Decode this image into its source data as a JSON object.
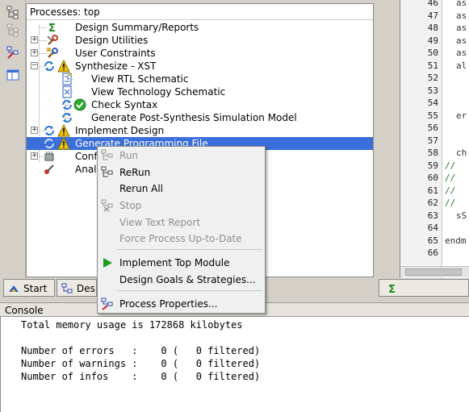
{
  "process_panel": {
    "header": "Processes: top",
    "items": [
      {
        "label": "Design Summary/Reports"
      },
      {
        "label": "Design Utilities"
      },
      {
        "label": "User Constraints"
      },
      {
        "label": "Synthesize - XST"
      },
      {
        "label": "View RTL Schematic"
      },
      {
        "label": "View Technology Schematic"
      },
      {
        "label": "Check Syntax"
      },
      {
        "label": "Generate Post-Synthesis Simulation Model"
      },
      {
        "label": "Implement Design"
      },
      {
        "label": "Generate Programming File"
      },
      {
        "label": "Conf"
      },
      {
        "label": "Anal"
      }
    ]
  },
  "panel_tabs": [
    {
      "label": "Start"
    },
    {
      "label": "Des"
    }
  ],
  "editor": {
    "lines": [
      {
        "num": "46",
        "text": "as"
      },
      {
        "num": "47",
        "text": "as"
      },
      {
        "num": "48",
        "text": "as"
      },
      {
        "num": "49",
        "text": "as"
      },
      {
        "num": "50",
        "text": "as"
      },
      {
        "num": "51",
        "text": "al"
      },
      {
        "num": "52",
        "text": ""
      },
      {
        "num": "53",
        "text": ""
      },
      {
        "num": "54",
        "text": ""
      },
      {
        "num": "55",
        "text": "er"
      },
      {
        "num": "56",
        "text": ""
      },
      {
        "num": "57",
        "text": ""
      },
      {
        "num": "58",
        "text": "ch"
      },
      {
        "num": "59",
        "text": "//"
      },
      {
        "num": "60",
        "text": "//"
      },
      {
        "num": "61",
        "text": "//"
      },
      {
        "num": "62",
        "text": "//"
      },
      {
        "num": "63",
        "text": "sS"
      },
      {
        "num": "64",
        "text": ""
      },
      {
        "num": "65",
        "text": "endm"
      },
      {
        "num": "66",
        "text": ""
      }
    ]
  },
  "console": {
    "title": "Console",
    "lines": [
      "Total memory usage is 172868 kilobytes",
      "",
      "Number of errors   :    0 (   0 filtered)",
      "Number of warnings :    0 (   0 filtered)",
      "Number of infos    :    0 (   0 filtered)"
    ]
  },
  "context_menu": {
    "run": "Run",
    "rerun": "ReRun",
    "rerun_all": "Rerun All",
    "stop": "Stop",
    "view_text_report": "View Text Report",
    "force_process": "Force Process Up-to-Date",
    "implement_top_module": "Implement Top Module",
    "design_goals": "Design Goals & Strategies...",
    "process_properties": "Process Properties..."
  },
  "colors": {
    "selection": "#3a6ed8",
    "warning": "#f5c400",
    "success": "#2ea82e",
    "play": "#1e9e1e",
    "comment": "#1a7a1a"
  },
  "icons": {
    "toolbar": [
      "hierarchy-icon",
      "hierarchy-disabled-icon",
      "process-properties-icon",
      "panel-icon"
    ],
    "tree": [
      "sigma-icon",
      "tools-icon",
      "constraints-icon",
      "run-cycle-icon",
      "warning-icon",
      "schematic-icon",
      "check-icon"
    ]
  }
}
